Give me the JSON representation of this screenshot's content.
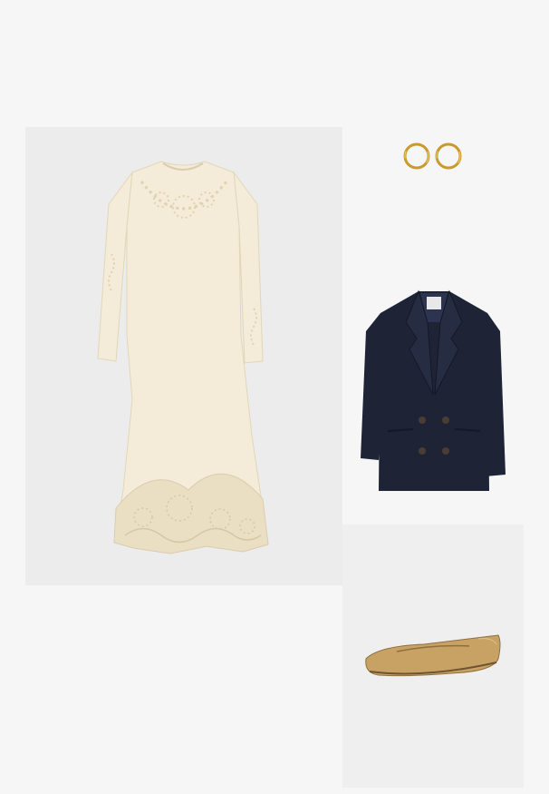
{
  "outfit": {
    "items": [
      {
        "name": "dress",
        "colors": {
          "fabric": "#f4ecd8",
          "lace": "#e8dcbf",
          "shadow": "#d9ccb0"
        }
      },
      {
        "name": "earrings",
        "colors": {
          "gold": "#c99a2e",
          "highlight": "#f0cf6a"
        }
      },
      {
        "name": "blazer",
        "colors": {
          "fabric": "#1e2436",
          "lapel": "#262d42",
          "buttons": "#4a3d33",
          "label": "#e8e8e8"
        }
      },
      {
        "name": "ballet-flat",
        "colors": {
          "leather": "#c8a265",
          "dark": "#8f6e3e",
          "sole": "#6e5531"
        }
      }
    ],
    "background": "#f6f6f6",
    "tile_backgrounds": {
      "dress": "#ececec",
      "shoes": "#efefef"
    }
  }
}
